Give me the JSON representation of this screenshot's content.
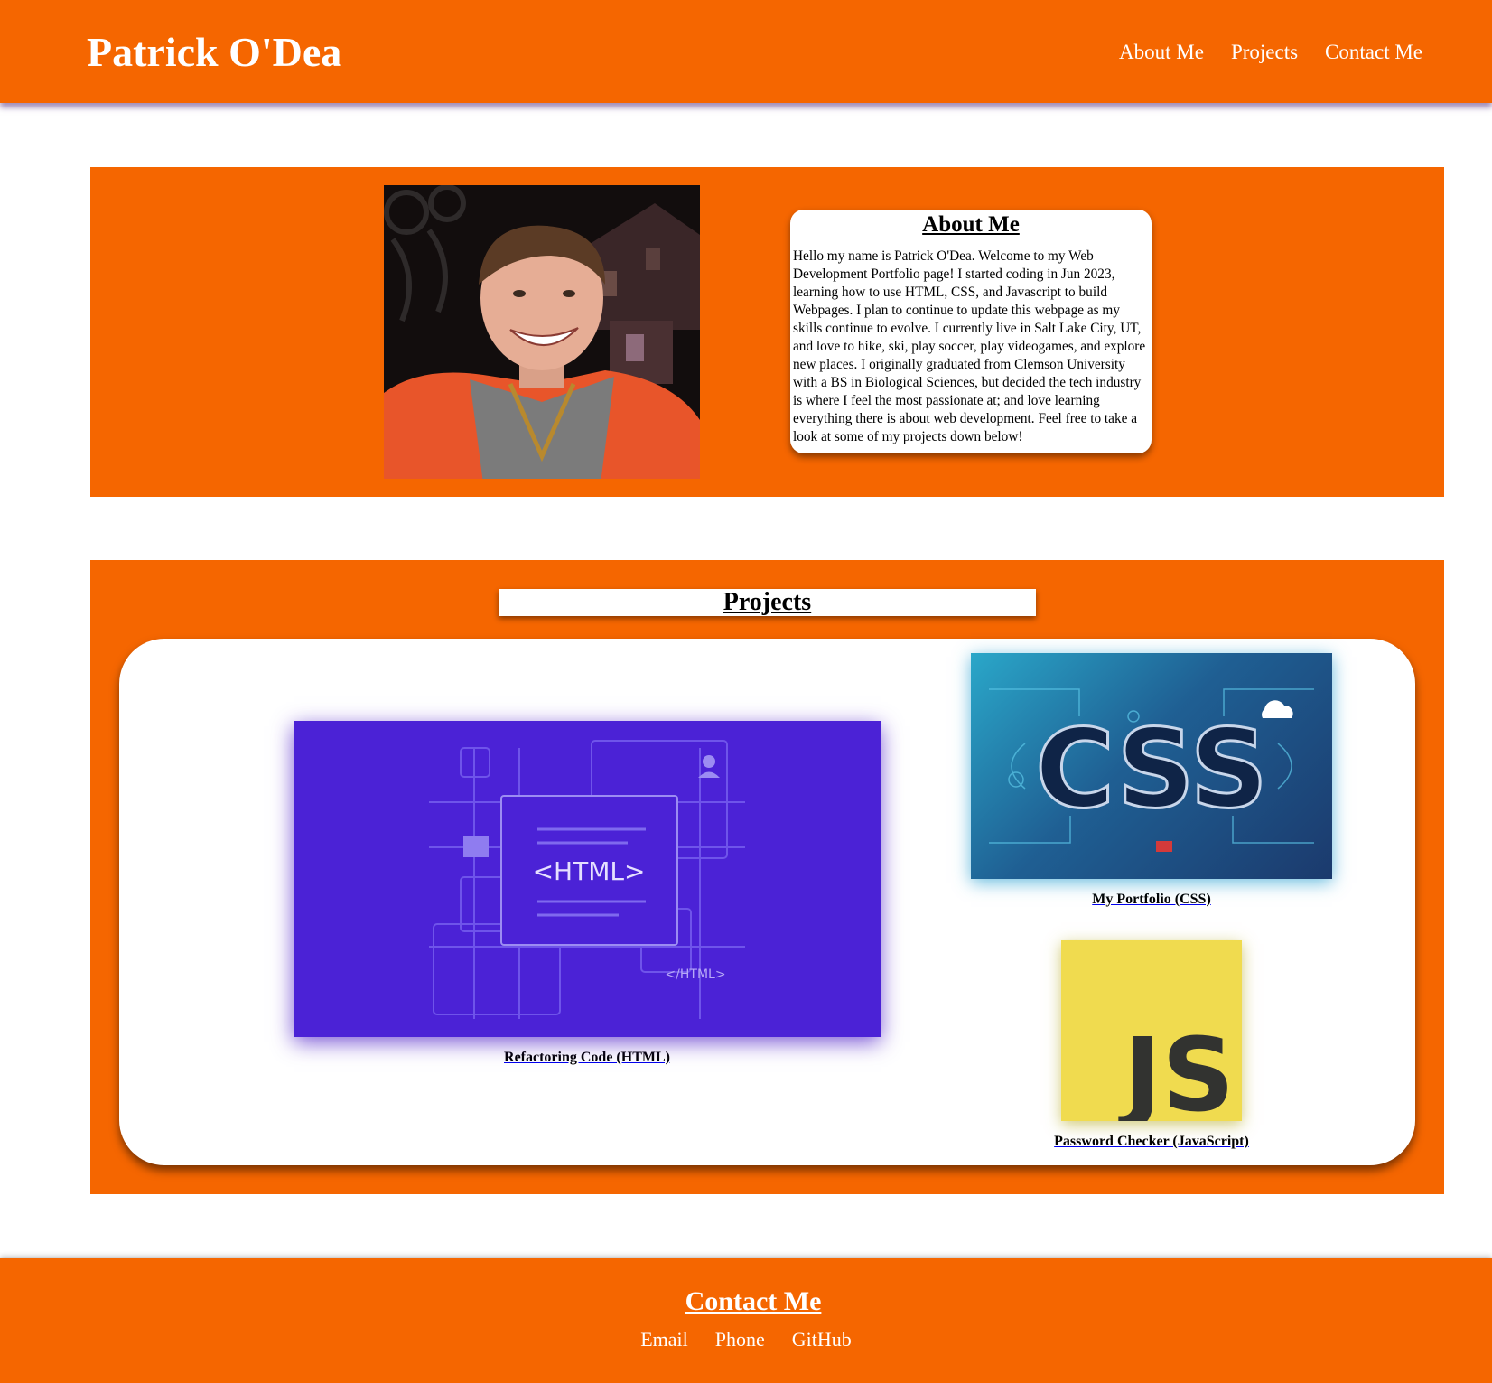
{
  "header": {
    "title": "Patrick O'Dea",
    "nav": [
      {
        "label": "About Me"
      },
      {
        "label": "Projects"
      },
      {
        "label": "Contact Me"
      }
    ]
  },
  "about": {
    "heading": "About Me",
    "photo_icon": "profile-photo",
    "text": "Hello my name is Patrick O'Dea. Welcome to my Web Development Portfolio page! I started coding in Jun 2023, learning how to use HTML, CSS, and Javascript to build Webpages. I plan to continue to update this webpage as my skills continue to evolve. I currently live in Salt Lake City, UT, and love to hike, ski, play soccer, play videogames, and explore new places. I originally graduated from Clemson University with a BS in Biological Sciences, but decided the tech industry is where I feel the most passionate at; and love learning everything there is about web development. Feel free to take a look at some of my projects down below!"
  },
  "projects": {
    "heading": "Projects",
    "items": [
      {
        "caption": "Refactoring Code (HTML)",
        "image_text": "<HTML>",
        "image_text_small": "</HTML>"
      },
      {
        "caption": "My Portfolio (CSS)",
        "image_text": "CSS"
      },
      {
        "caption": "Password Checker (JavaScript)",
        "image_text": "JS"
      }
    ]
  },
  "footer": {
    "heading": "Contact Me",
    "links": [
      {
        "label": "Email"
      },
      {
        "label": "Phone"
      },
      {
        "label": "GitHub"
      }
    ]
  },
  "colors": {
    "brand_orange": "#f56600",
    "html_purple": "#4b22d6",
    "js_yellow": "#f0db4f"
  }
}
